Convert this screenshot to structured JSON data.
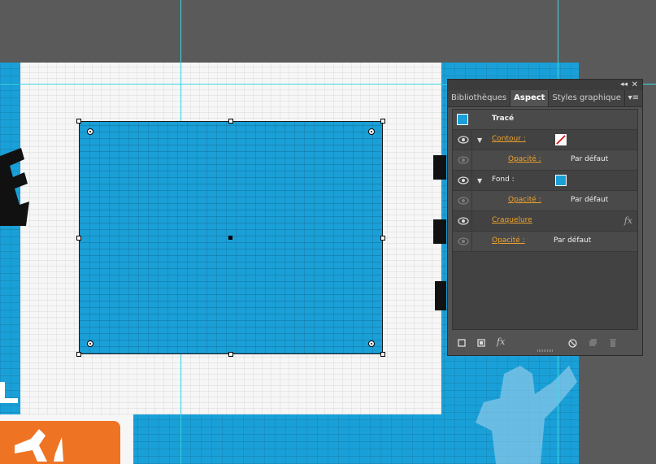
{
  "panel": {
    "collapse_label": "◂◂",
    "close_label": "✕",
    "tabs": [
      "Bibliothèques",
      "Aspect",
      "Styles graphique"
    ],
    "menu_label": "▾≡",
    "header": {
      "label": "Tracé",
      "swatch_color": "#1a9fd7"
    },
    "rows": {
      "contour_label": "Contour :",
      "contour_opacity_label": "Opacité :",
      "contour_opacity_value": "Par défaut",
      "fond_label": "Fond :",
      "fond_swatch_color": "#1a9fd7",
      "fond_opacity_label": "Opacité :",
      "fond_opacity_value": "Par défaut",
      "effect_label": "Craquelure",
      "effect_icon": "fx",
      "global_opacity_label": "Opacité :",
      "global_opacity_value": "Par défaut"
    },
    "footer": {
      "fx_label": "fx"
    }
  },
  "colors": {
    "accent_orange": "#f0a32a",
    "artwork_blue": "#1aa0d8",
    "guide_cyan": "#3fd6e6"
  }
}
